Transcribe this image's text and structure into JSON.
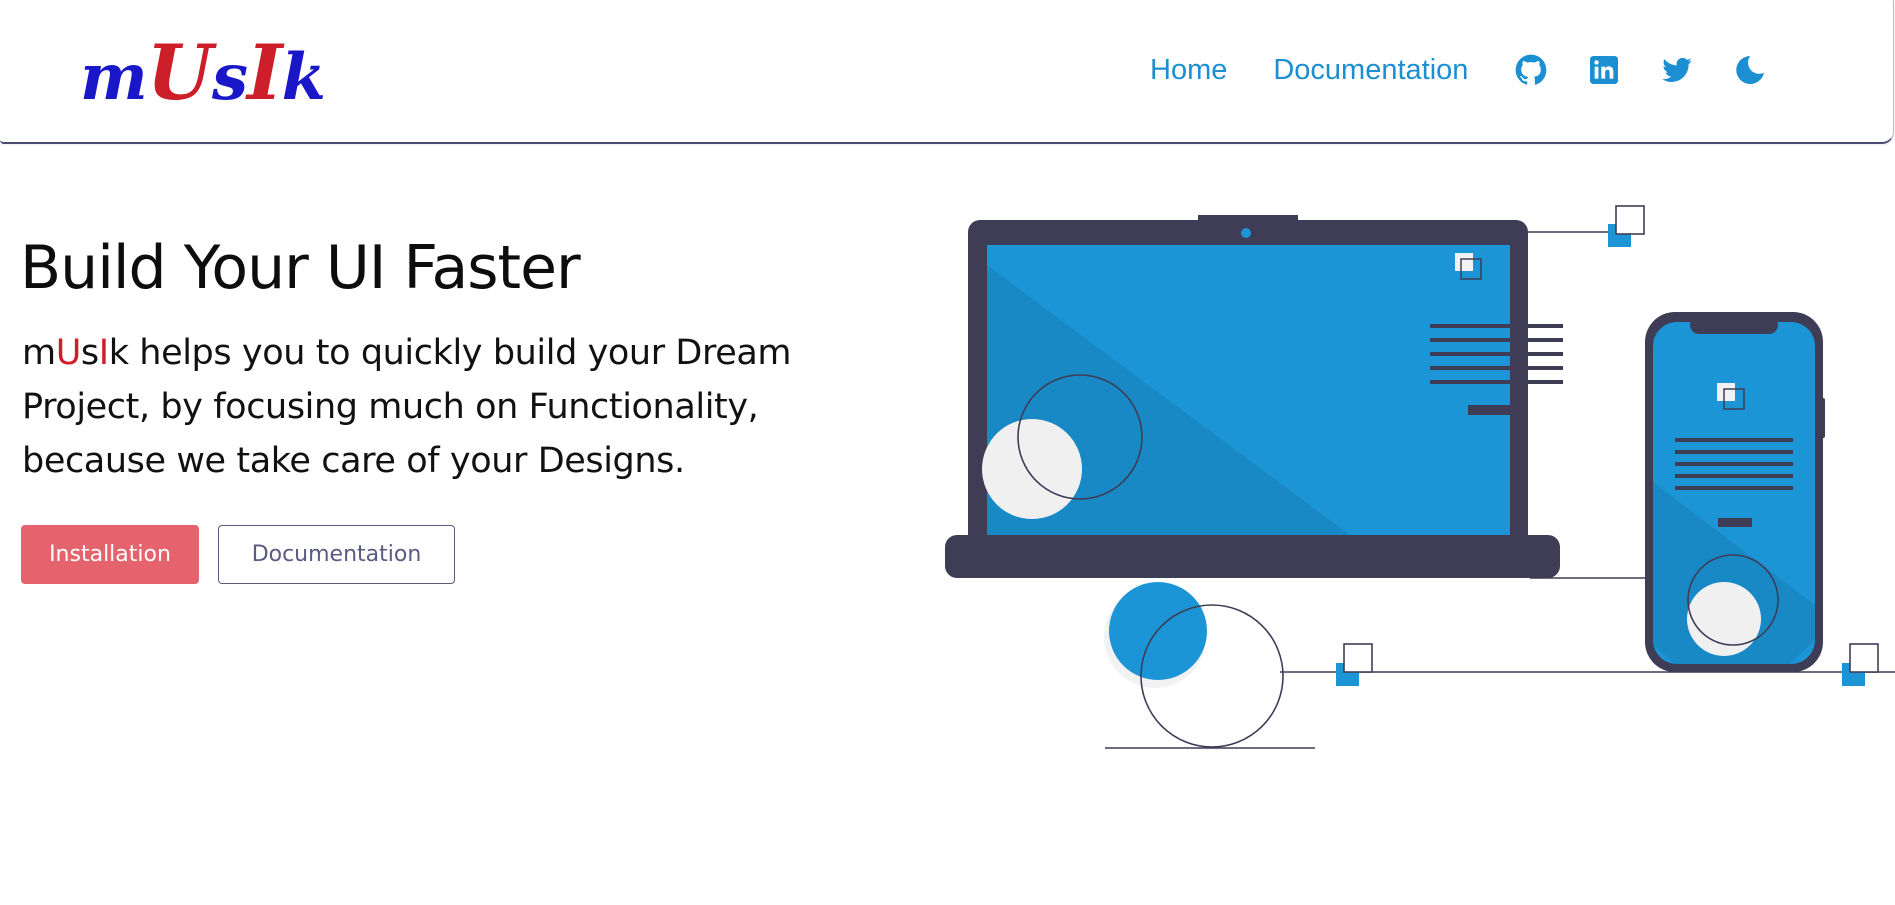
{
  "header": {
    "logo": {
      "l1": "m",
      "l2": "U",
      "l3": "s",
      "l4": "I",
      "l5": "k"
    },
    "nav": {
      "home_label": "Home",
      "documentation_label": "Documentation"
    },
    "icons": [
      "github-icon",
      "linkedin-icon",
      "twitter-icon",
      "moon-icon"
    ]
  },
  "hero": {
    "title": "Build Your UI Faster",
    "brand": {
      "l1": "m",
      "l2": "U",
      "l3": "s",
      "l4": "I",
      "l5": "k"
    },
    "description_rest": " helps you to quickly build your Dream Project, by focusing much on Functionality, because we take care of your Designs.",
    "installation_button": "Installation",
    "documentation_button": "Documentation"
  },
  "colors": {
    "accent_blue": "#1b8fd1",
    "brand_red": "#cc1f2a",
    "brand_blue": "#1a17c9",
    "install_button": "#e5636c",
    "device_dark": "#3f3d56",
    "screen_blue": "#1c95d6"
  }
}
